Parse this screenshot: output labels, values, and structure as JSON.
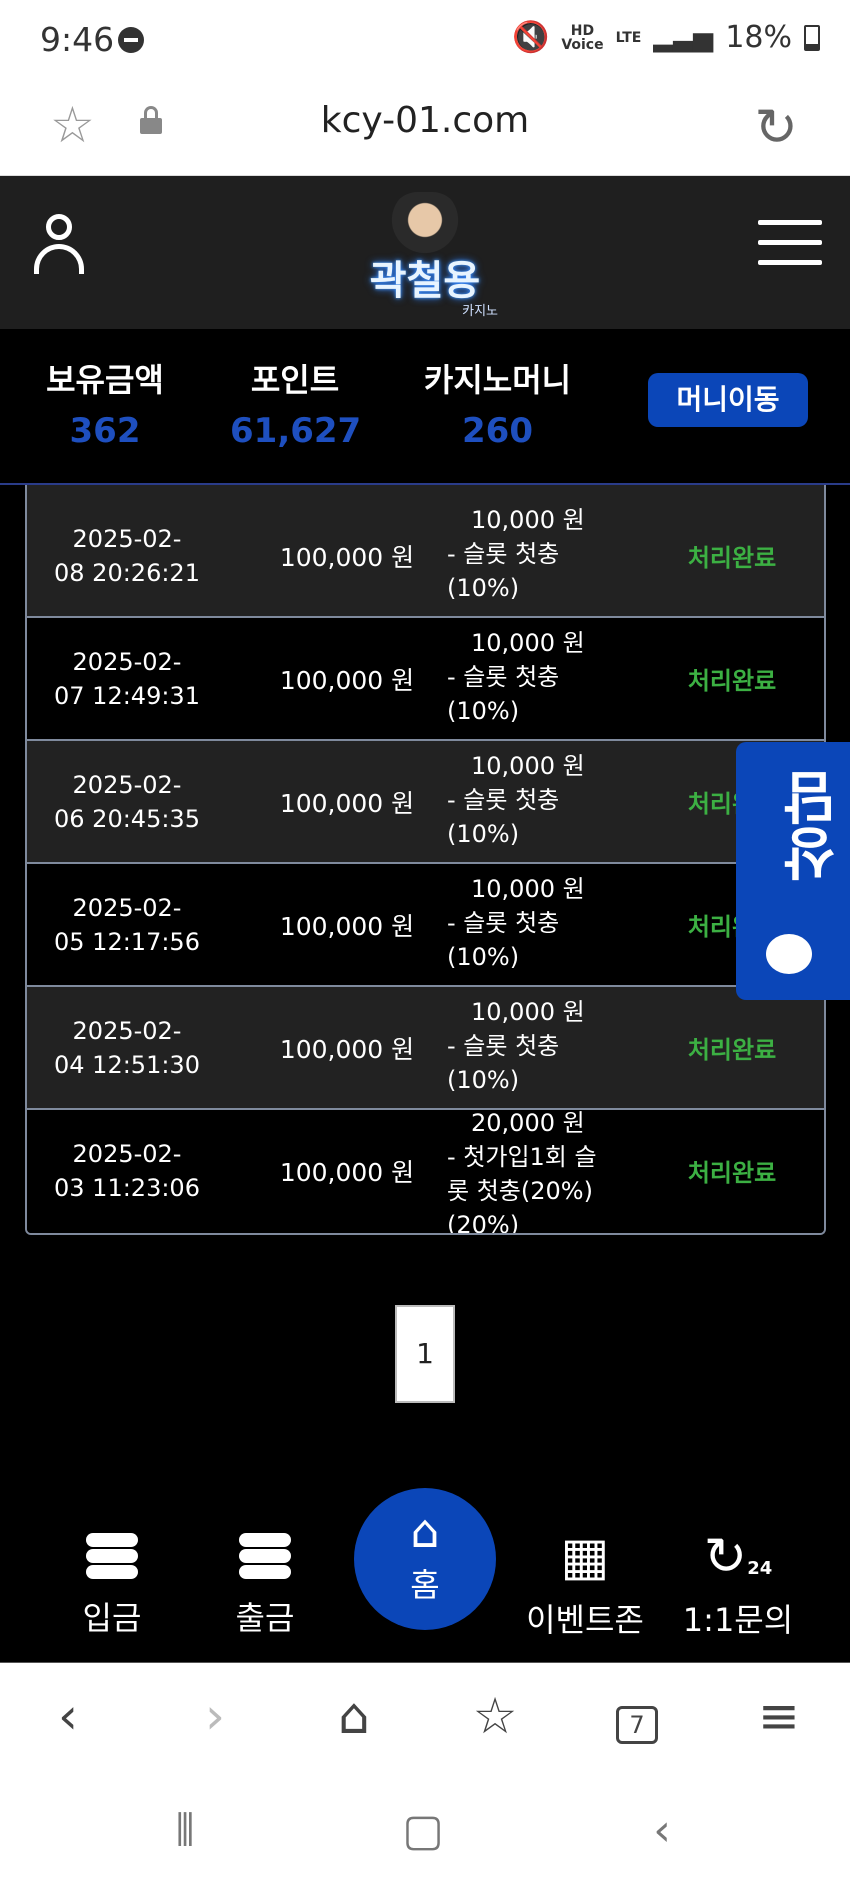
{
  "status_bar": {
    "time": "9:46",
    "battery": "18%",
    "hd": "HD",
    "voice": "Voice",
    "lte": "LTE"
  },
  "browser": {
    "url": "kcy-01.com",
    "tabs_count": "7"
  },
  "header": {
    "logo_text": "곽철용",
    "logo_sub": "카지노"
  },
  "balance": {
    "holding_label": "보유금액",
    "holding_value": "362",
    "point_label": "포인트",
    "point_value": "61,627",
    "casino_label": "카지노머니",
    "casino_value": "260",
    "move_button": "머니이동"
  },
  "rows": [
    {
      "date_line1": "2025-02-",
      "date_line2": "08 20:26:21",
      "amount": "100,000 원",
      "bonus_line1": "10,000 원",
      "bonus_line2": "- 슬롯 첫충",
      "bonus_line3": "(10%)",
      "bonus_line4": "",
      "status": "처리완료"
    },
    {
      "date_line1": "2025-02-",
      "date_line2": "07 12:49:31",
      "amount": "100,000 원",
      "bonus_line1": "10,000 원",
      "bonus_line2": "- 슬롯 첫충",
      "bonus_line3": "(10%)",
      "bonus_line4": "",
      "status": "처리완료"
    },
    {
      "date_line1": "2025-02-",
      "date_line2": "06 20:45:35",
      "amount": "100,000 원",
      "bonus_line1": "10,000 원",
      "bonus_line2": "- 슬롯 첫충",
      "bonus_line3": "(10%)",
      "bonus_line4": "",
      "status": "처리완료"
    },
    {
      "date_line1": "2025-02-",
      "date_line2": "05 12:17:56",
      "amount": "100,000 원",
      "bonus_line1": "10,000 원",
      "bonus_line2": "- 슬롯 첫충",
      "bonus_line3": "(10%)",
      "bonus_line4": "",
      "status": "처리완료"
    },
    {
      "date_line1": "2025-02-",
      "date_line2": "04 12:51:30",
      "amount": "100,000 원",
      "bonus_line1": "10,000 원",
      "bonus_line2": "- 슬롯 첫충",
      "bonus_line3": "(10%)",
      "bonus_line4": "",
      "status": "처리완료"
    },
    {
      "date_line1": "2025-02-",
      "date_line2": "03 11:23:06",
      "amount": "100,000 원",
      "bonus_line1": "20,000 원",
      "bonus_line2": "- 첫가입1회 슬",
      "bonus_line3": "롯 첫충(20%)",
      "bonus_line4": "(20%)",
      "status": "처리완료"
    }
  ],
  "chat_tab": {
    "label": "상담"
  },
  "pagination": {
    "current": "1"
  },
  "bottom_nav": {
    "deposit": "입금",
    "withdraw": "출금",
    "home": "홈",
    "event": "이벤트존",
    "inquiry": "1:1문의",
    "inquiry_badge": "24"
  },
  "colors": {
    "accent": "#0b46b8",
    "status_green": "#3cb043",
    "value_blue": "#1e4fbf"
  }
}
